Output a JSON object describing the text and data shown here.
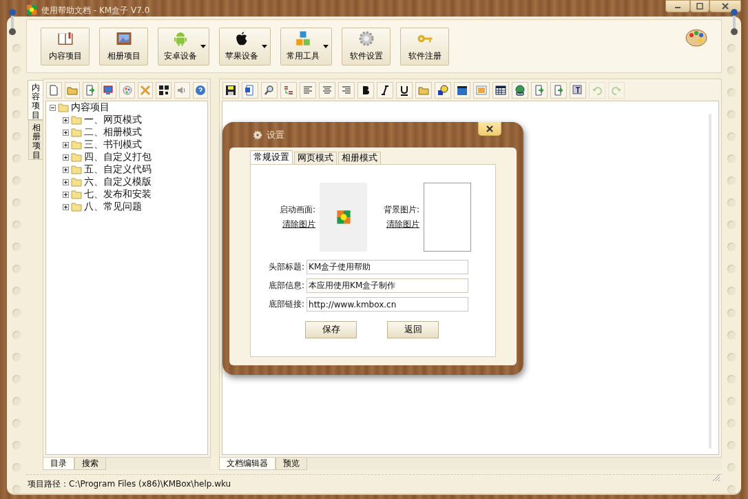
{
  "window": {
    "title": "使用帮助文档 - KM盒子 V7.0"
  },
  "toolbar": [
    {
      "label": "内容项目",
      "kind": "book",
      "dropdown": false
    },
    {
      "label": "相册项目",
      "kind": "picture",
      "dropdown": false
    },
    {
      "label": "安卓设备",
      "kind": "robot",
      "dropdown": true
    },
    {
      "label": "苹果设备",
      "kind": "apple",
      "dropdown": true
    },
    {
      "label": "常用工具",
      "kind": "blocks",
      "dropdown": true
    },
    {
      "label": "软件设置",
      "kind": "gear",
      "dropdown": false
    },
    {
      "label": "软件注册",
      "kind": "key",
      "dropdown": false
    }
  ],
  "side_tabs": [
    {
      "label": "内容项目",
      "selected": true
    },
    {
      "label": "相册项目",
      "selected": false
    }
  ],
  "tree_tools": [
    {
      "kind": "new"
    },
    {
      "kind": "open"
    },
    {
      "kind": "export"
    },
    {
      "kind": "monitor"
    },
    {
      "kind": "paint"
    },
    {
      "kind": "tools"
    },
    {
      "kind": "qr"
    },
    {
      "kind": "speaker"
    },
    {
      "kind": "help"
    }
  ],
  "tree": {
    "label": "内容项目",
    "expanded": true,
    "children": [
      {
        "label": "一、网页模式",
        "expanded": false
      },
      {
        "label": "二、相册模式",
        "expanded": false
      },
      {
        "label": "三、书刊模式",
        "expanded": false
      },
      {
        "label": "四、自定义打包",
        "expanded": false
      },
      {
        "label": "五、自定义代码",
        "expanded": false
      },
      {
        "label": "六、自定义模版",
        "expanded": false
      },
      {
        "label": "七、发布和安装",
        "expanded": false
      },
      {
        "label": "八、常见问题",
        "expanded": false
      }
    ]
  },
  "left_tabs": [
    {
      "label": "目录",
      "selected": true
    },
    {
      "label": "搜索",
      "selected": false
    }
  ],
  "editor_tools": [
    {
      "kind": "save",
      "disabled": false
    },
    {
      "kind": "word",
      "disabled": false
    },
    {
      "kind": "find",
      "disabled": false
    },
    {
      "kind": "replace",
      "disabled": false
    },
    {
      "kind": "align-left",
      "disabled": false
    },
    {
      "kind": "align-center",
      "disabled": false
    },
    {
      "kind": "align-right",
      "disabled": false
    },
    {
      "kind": "bold",
      "disabled": false
    },
    {
      "kind": "italic",
      "disabled": false
    },
    {
      "kind": "underline",
      "disabled": false
    },
    {
      "kind": "folder",
      "disabled": false
    },
    {
      "kind": "font",
      "disabled": false
    },
    {
      "kind": "video",
      "disabled": false
    },
    {
      "kind": "image",
      "disabled": false
    },
    {
      "kind": "table",
      "disabled": false
    },
    {
      "kind": "link",
      "disabled": false
    },
    {
      "kind": "import",
      "disabled": false
    },
    {
      "kind": "export",
      "disabled": false
    },
    {
      "kind": "clear",
      "disabled": false
    },
    {
      "kind": "undo",
      "disabled": true
    },
    {
      "kind": "redo",
      "disabled": true
    }
  ],
  "editor_tabs": [
    {
      "label": "文档编辑器",
      "selected": true
    },
    {
      "label": "预览",
      "selected": false
    }
  ],
  "status_bar": "项目路径：C:\\Program Files (x86)\\KMBox\\help.wku",
  "dialog": {
    "title": "设置",
    "tabs": [
      {
        "label": "常规设置",
        "selected": true
      },
      {
        "label": "网页模式",
        "selected": false
      },
      {
        "label": "相册模式",
        "selected": false
      }
    ],
    "splash": {
      "label": "启动画面:",
      "link": "清除图片"
    },
    "background": {
      "label": "背景图片:",
      "link": "清除图片"
    },
    "fields": [
      {
        "label": "头部标题:",
        "value": "KM盒子使用帮助"
      },
      {
        "label": "底部信息:",
        "value": "本应用使用KM盒子制作"
      },
      {
        "label": "底部链接:",
        "value": "http://www.kmbox.cn"
      }
    ],
    "buttons": [
      "保存",
      "返回"
    ]
  }
}
